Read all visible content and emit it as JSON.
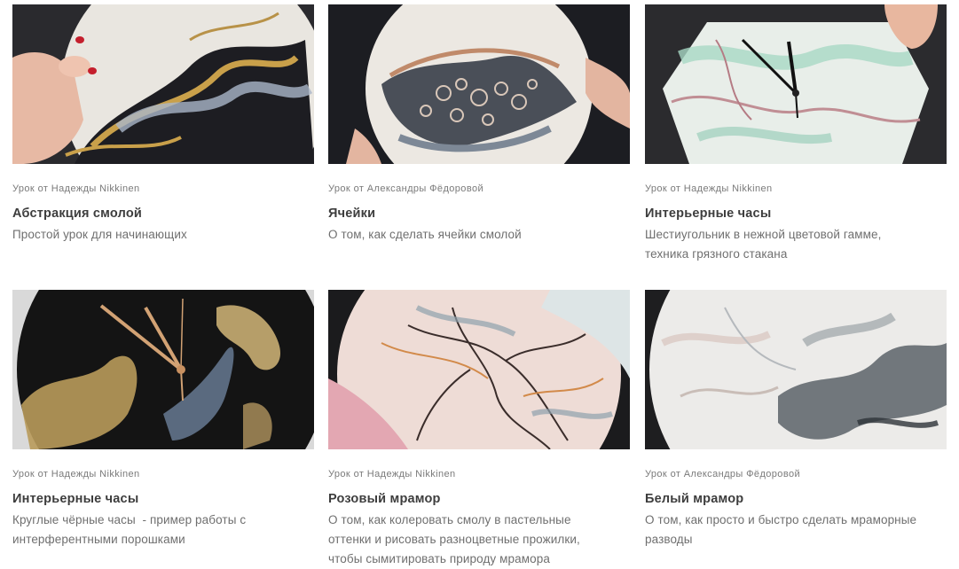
{
  "cards": [
    {
      "author": "Урок от Надежды Nikkinen",
      "title": "Абстракция смолой",
      "desc_lines": [
        "Простой урок для начинающих"
      ]
    },
    {
      "author": "Урок от Александры Фёдоровой",
      "title": "Ячейки",
      "desc_lines": [
        "О том, как сделать ячейки смолой"
      ]
    },
    {
      "author": "Урок от Надежды Nikkinen",
      "title": "Интерьерные часы",
      "desc_lines": [
        "Шестиугольник в нежной цветовой гамме,",
        "техника грязного стакана"
      ]
    },
    {
      "author": "Урок от Надежды Nikkinen",
      "title": "Интерьерные часы",
      "desc_lines": [
        "Круглые чёрные часы  - пример работы с",
        "интерферентными порошками"
      ]
    },
    {
      "author": "Урок от Надежды Nikkinen",
      "title": "Розовый мрамор",
      "desc_lines": [
        "О том, как колеровать смолу в пастельные",
        "оттенки и рисовать разноцветные прожилки,",
        "чтобы сымитировать природу мрамора"
      ]
    },
    {
      "author": "Урок от Александры Фёдоровой",
      "title": "Белый мрамор",
      "desc_lines": [
        "О том, как просто и быстро сделать мраморные",
        "разводы"
      ]
    }
  ]
}
